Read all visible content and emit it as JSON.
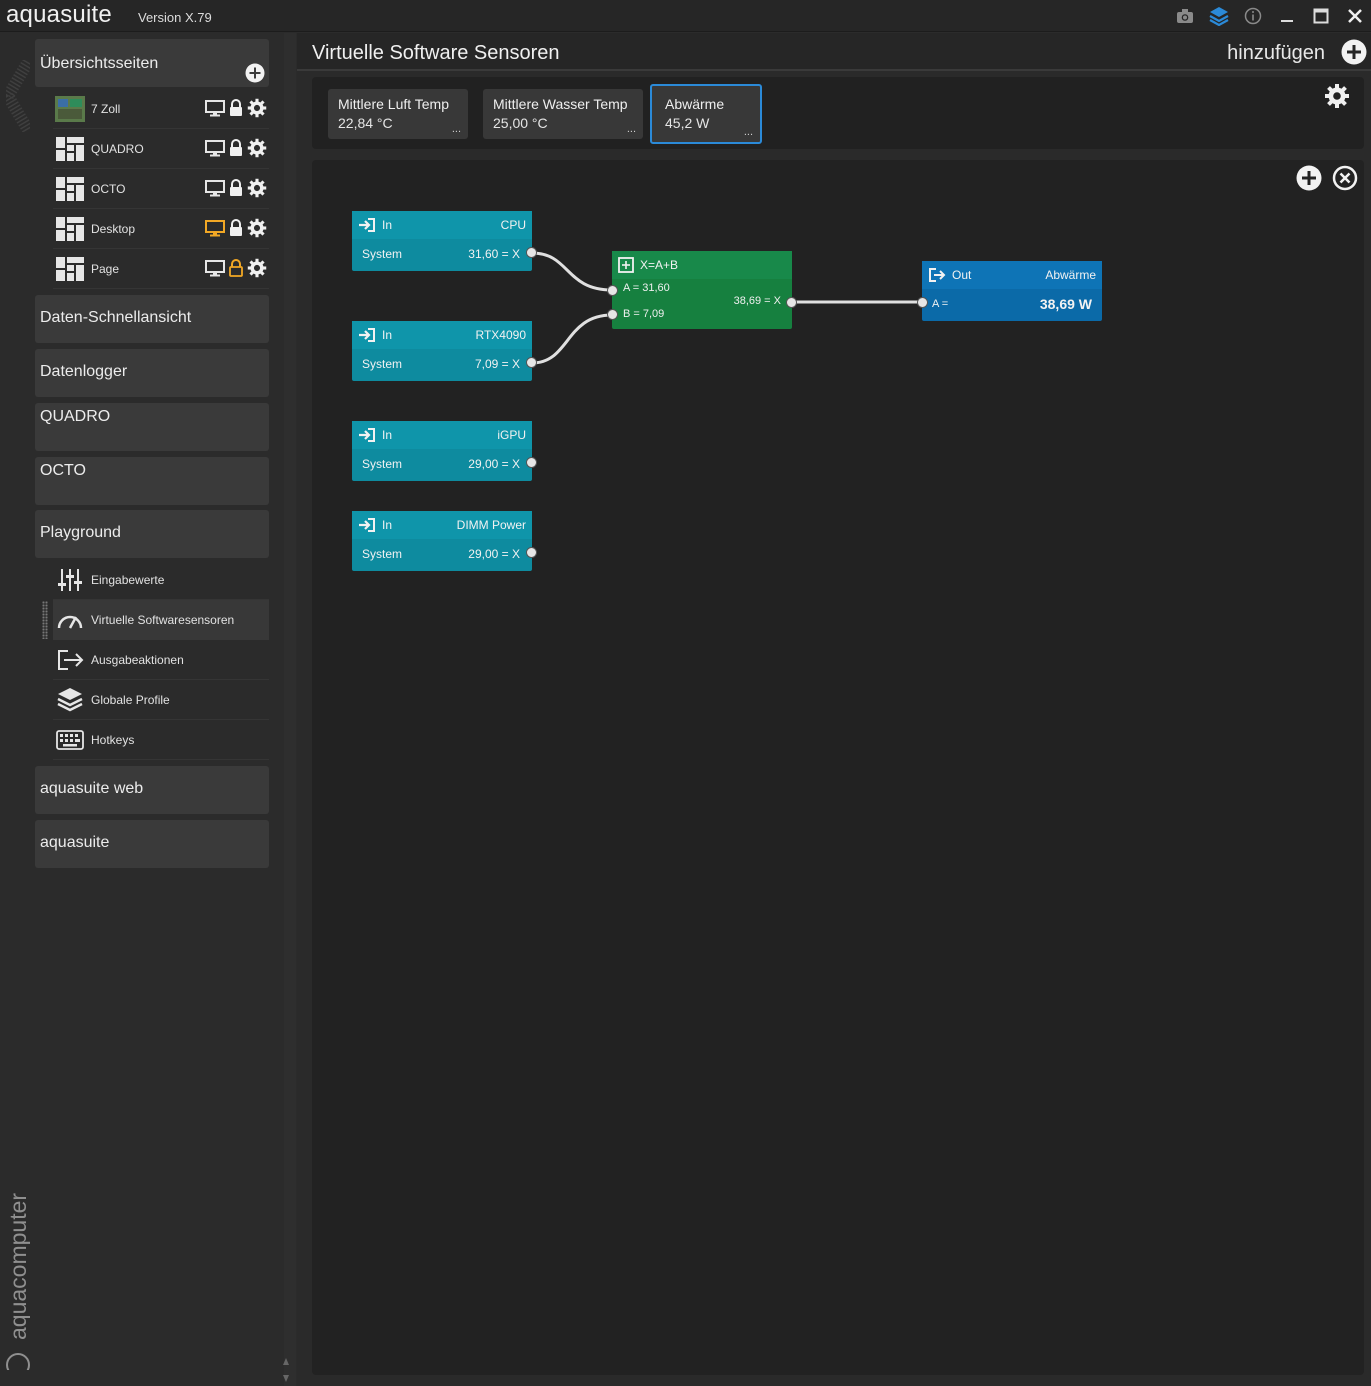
{
  "app": {
    "name": "aquasuite",
    "version": "Version X.79"
  },
  "titlebar_icons": [
    "camera-icon",
    "layers-icon",
    "info-icon",
    "minimize-icon",
    "maximize-icon",
    "close-icon"
  ],
  "sidebar": {
    "overview": {
      "label": "Übersichtsseiten",
      "pages": [
        {
          "label": "7 Zoll",
          "monitor_color": "#e6e6e6",
          "lock": "locked"
        },
        {
          "label": "QUADRO",
          "monitor_color": "#e6e6e6",
          "lock": "locked"
        },
        {
          "label": "OCTO",
          "monitor_color": "#e6e6e6",
          "lock": "locked"
        },
        {
          "label": "Desktop",
          "monitor_color": "#f2a825",
          "lock": "locked"
        },
        {
          "label": "Page",
          "monitor_color": "#e6e6e6",
          "lock": "unlocked"
        }
      ]
    },
    "sections": {
      "quick_view": "Daten-Schnellansicht",
      "logger": "Datenlogger",
      "quadro": "QUADRO",
      "octo": "OCTO",
      "playground": "Playground",
      "web": "aquasuite web",
      "aquasuite": "aquasuite"
    },
    "playground_items": [
      {
        "label": "Eingabewerte",
        "icon": "sliders-icon"
      },
      {
        "label": "Virtuelle Softwaresensoren",
        "icon": "gauge-icon",
        "selected": true
      },
      {
        "label": "Ausgabeaktionen",
        "icon": "export-icon"
      },
      {
        "label": "Globale Profile",
        "icon": "layers-icon"
      },
      {
        "label": "Hotkeys",
        "icon": "keyboard-icon"
      }
    ],
    "brand": "aquacomputer"
  },
  "main": {
    "title": "Virtuelle Software Sensoren",
    "add_label": "hinzufügen",
    "tabs": [
      {
        "name": "Mittlere Luft Temp",
        "value": "22,84 °C",
        "more": "..."
      },
      {
        "name": "Mittlere Wasser Temp",
        "value": "25,00 °C",
        "more": "..."
      },
      {
        "name": "Abwärme",
        "value": "45,2 W",
        "more": "...",
        "active": true
      }
    ]
  },
  "nodes": {
    "inputs": [
      {
        "type": "In",
        "name": "CPU",
        "source": "System",
        "value": "31,60 = X"
      },
      {
        "type": "In",
        "name": "RTX4090",
        "source": "System",
        "value": "7,09 = X"
      },
      {
        "type": "In",
        "name": "iGPU",
        "source": "System",
        "value": "29,00 = X"
      },
      {
        "type": "In",
        "name": "DIMM Power",
        "source": "System",
        "value": "29,00 = X"
      }
    ],
    "calc": {
      "formula": "X=A+B",
      "a": "A = 31,60",
      "b": "B = 7,09",
      "result": "38,69 = X"
    },
    "output": {
      "type": "Out",
      "name": "Abwärme",
      "label": "A =",
      "value": "38,69 W"
    }
  },
  "colors": {
    "accent": "#2b8ad8",
    "input_node": "#0e8b9f",
    "calc_node": "#16803f",
    "output_node": "#0b6aa8",
    "highlight": "#f2a825"
  }
}
